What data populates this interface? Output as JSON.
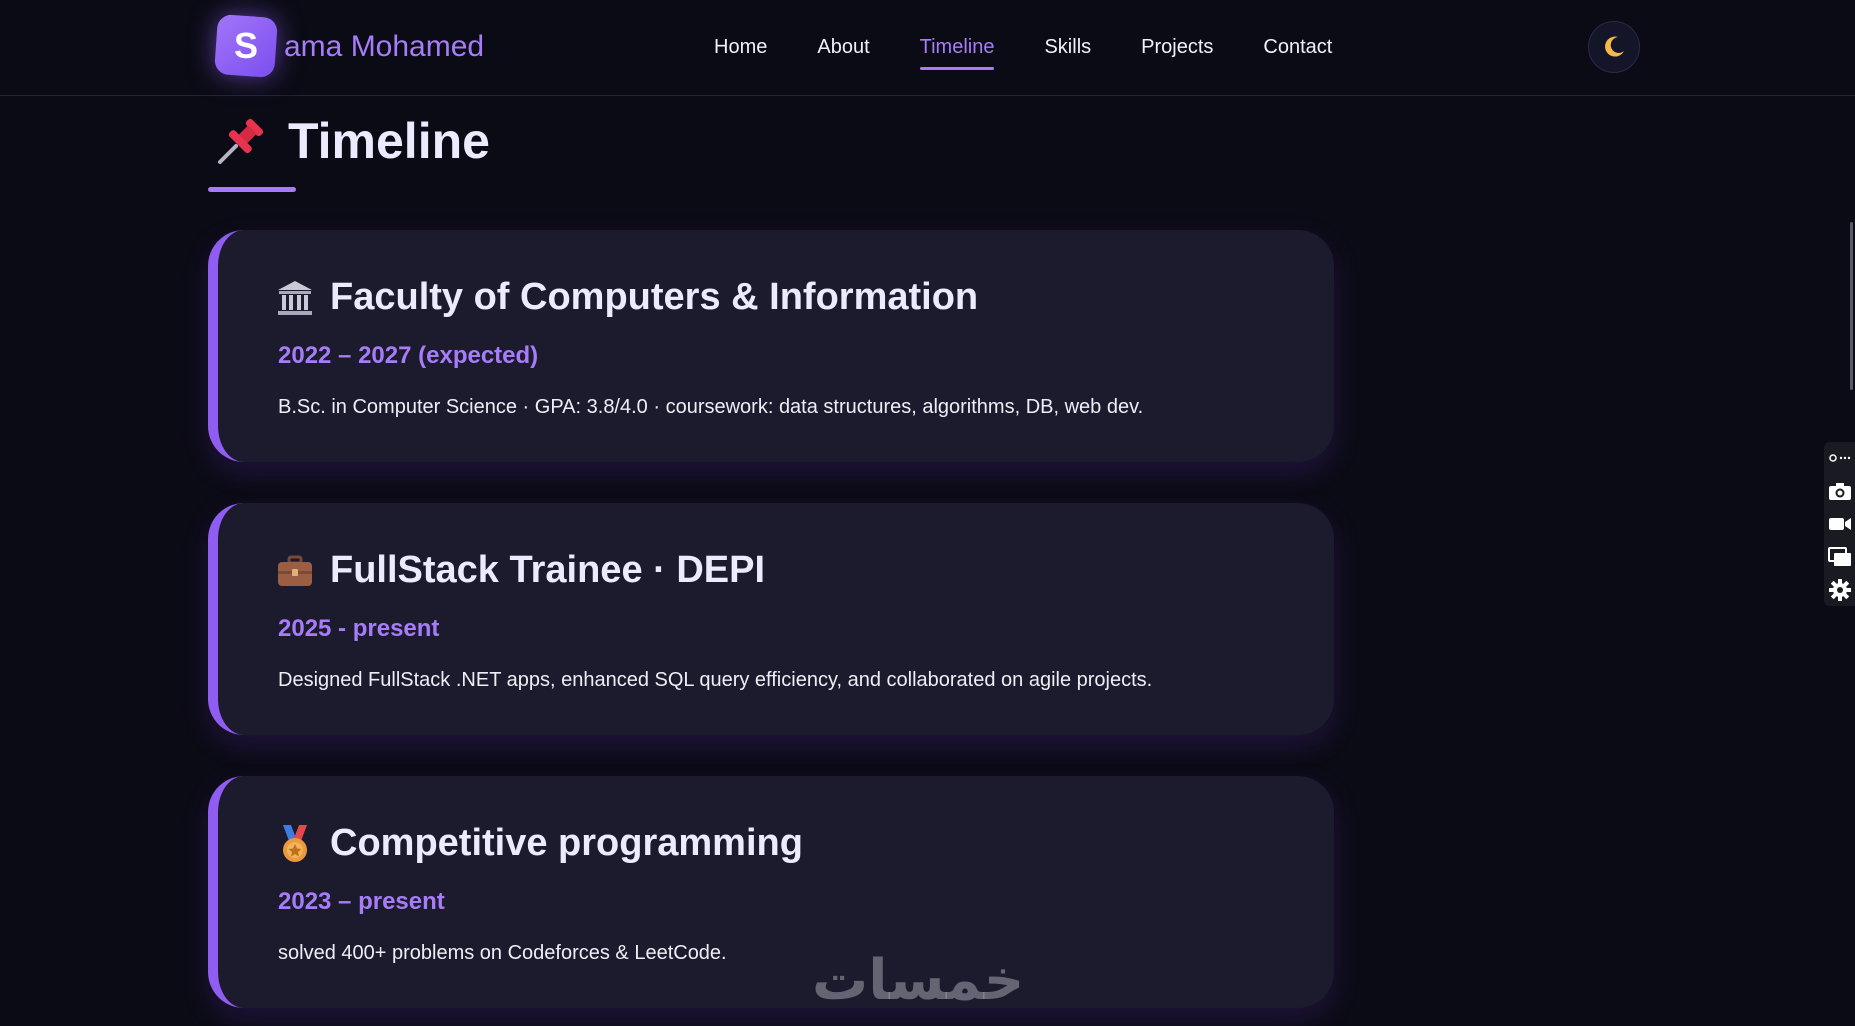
{
  "header": {
    "logo_letter": "S",
    "brand_name": "ama Mohamed",
    "nav": [
      {
        "label": "Home"
      },
      {
        "label": "About"
      },
      {
        "label": "Timeline",
        "active": true
      },
      {
        "label": "Skills"
      },
      {
        "label": "Projects"
      },
      {
        "label": "Contact"
      }
    ],
    "theme_toggle_icon": "moon-icon"
  },
  "page": {
    "title": "Timeline",
    "title_icon": "pushpin-icon"
  },
  "timeline": [
    {
      "icon": "classical-building-icon",
      "title": "Faculty of Computers & Information",
      "date": "2022 – 2027 (expected)",
      "description": "B.Sc. in Computer Science · GPA: 3.8/4.0 · coursework: data structures, algorithms, DB, web dev."
    },
    {
      "icon": "briefcase-icon",
      "title": "FullStack Trainee · DEPI",
      "date": "2025 - present",
      "description": "Designed FullStack .NET apps, enhanced SQL query efficiency, and collaborated on agile projects."
    },
    {
      "icon": "medal-icon",
      "title": "Competitive programming",
      "date": "2023 – present",
      "description": "solved 400+ problems on Codeforces & LeetCode."
    }
  ],
  "watermark": "خمسات",
  "colors": {
    "accent": "#a77cf9",
    "background": "#0b0b15",
    "card": "#1b1b2d"
  }
}
